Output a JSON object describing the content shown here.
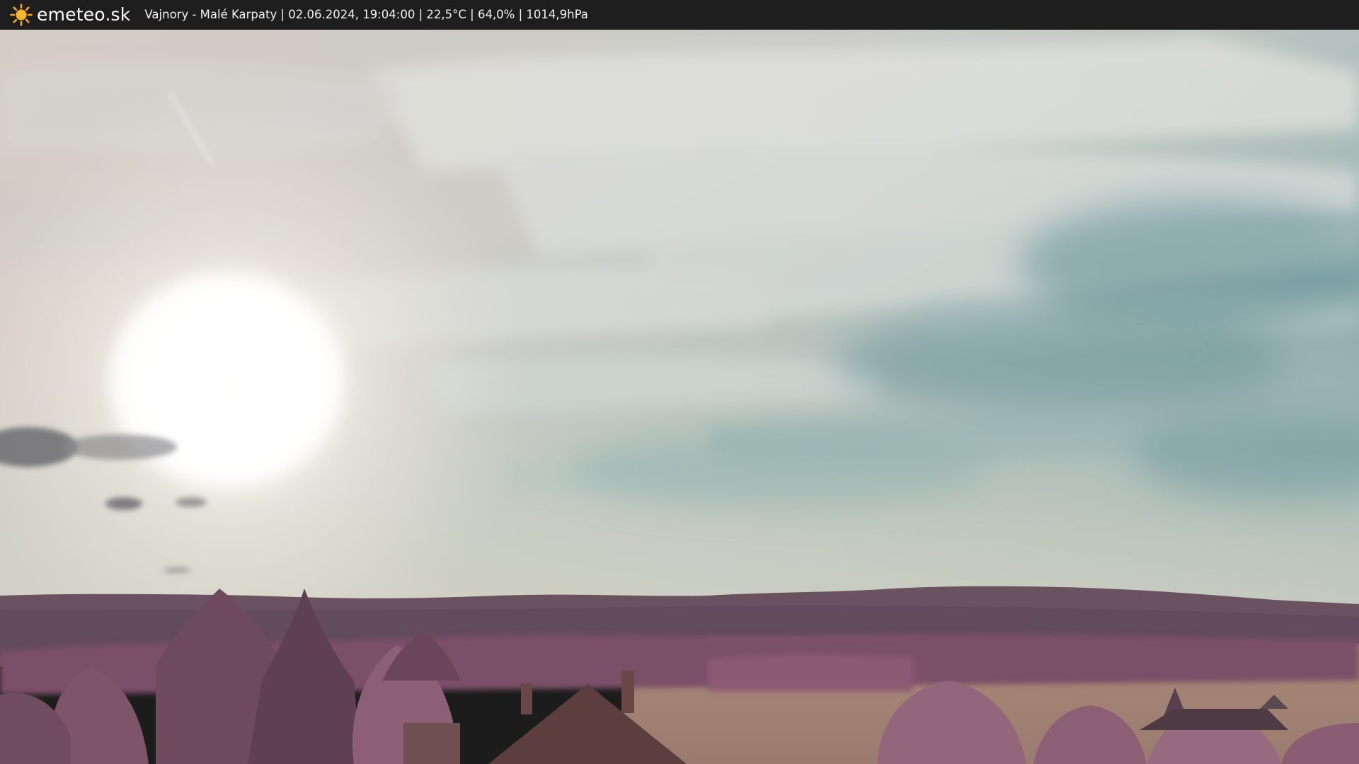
{
  "header": {
    "logo_text": "emeteo.sk",
    "caption": "Vajnory - Malé Karpaty | 02.06.2024, 19:04:00 | 22,5°C | 64,0% | 1014,9hPa"
  },
  "icons": {
    "logo": "sun-icon"
  },
  "colors": {
    "bar_background": "#1e1e1e",
    "bar_text": "#ffffff",
    "logo_sun": "#f5a623",
    "sky_teal": "#7fa5a6",
    "foliage": "#7a5068"
  }
}
